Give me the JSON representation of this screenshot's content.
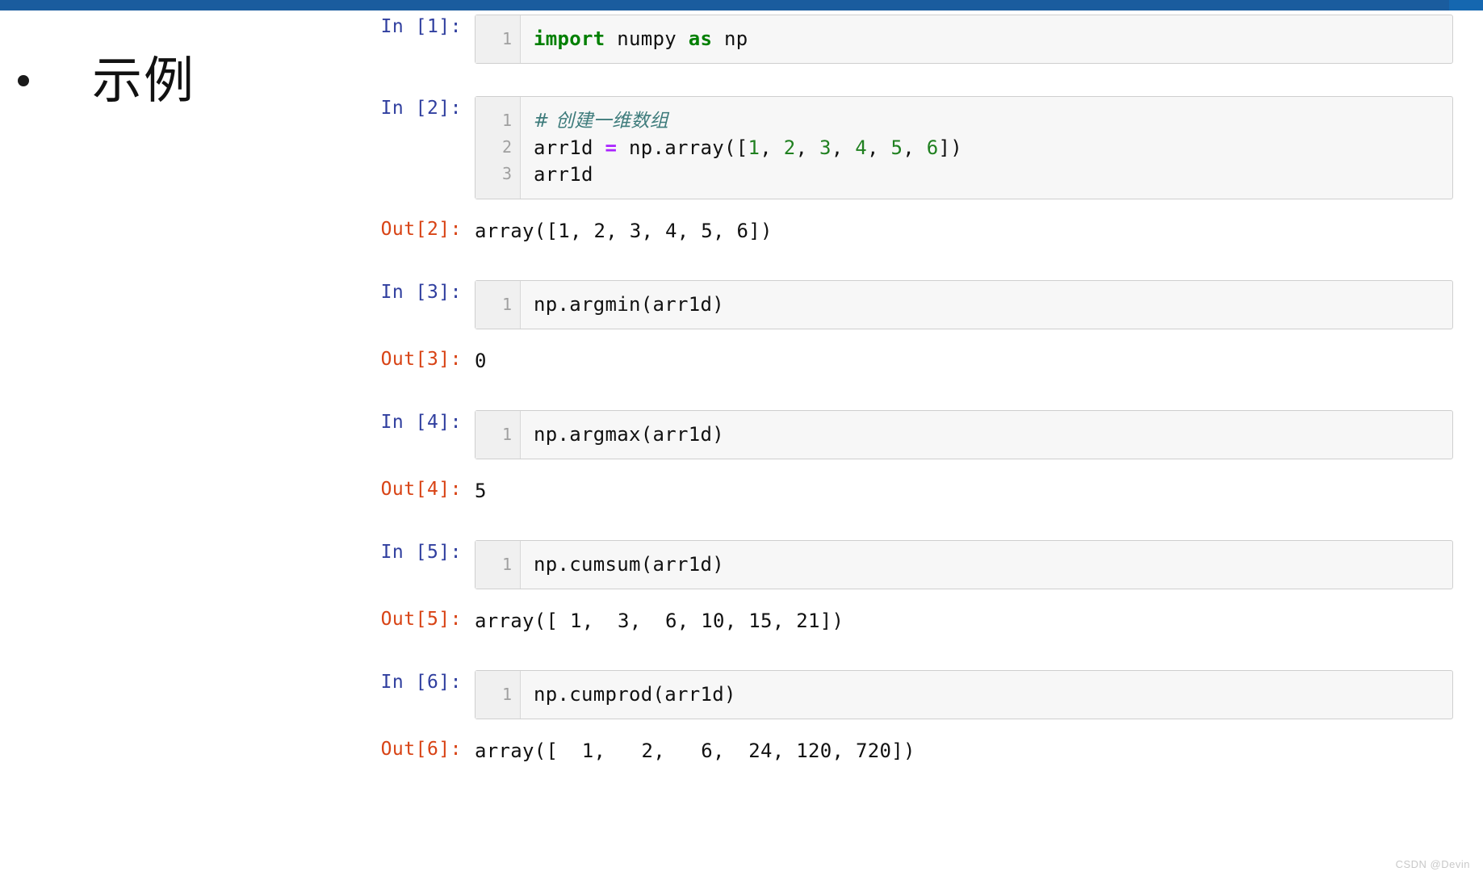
{
  "theme": {
    "top_bar_color": "#1A5C9E",
    "top_bar_accent_color": "#1567B0",
    "in_prompt_color": "#303F9F",
    "out_prompt_color": "#D84315",
    "keyword_color": "#007F00",
    "number_color": "#208020",
    "operator_color": "#AA22FF",
    "comment_color": "#3D7B7B",
    "cell_background": "#f7f7f7",
    "cell_border": "#cfcfcf"
  },
  "slide": {
    "bullet_text": "示例",
    "bullet_marker": "•"
  },
  "watermark": {
    "text": "CSDN @Devin"
  },
  "notebook": {
    "cells": [
      {
        "prompt": "In [1]:",
        "line_numbers": "1",
        "code_tokens": [
          {
            "text": "import",
            "type": "keyword"
          },
          {
            "text": " numpy ",
            "type": "plain"
          },
          {
            "text": "as",
            "type": "keyword"
          },
          {
            "text": " np",
            "type": "plain"
          }
        ],
        "code_plain": "import numpy as np",
        "output": null
      },
      {
        "prompt": "In [2]:",
        "line_numbers": "1\n2\n3",
        "code_tokens": [
          {
            "text": "# 创建一维数组",
            "type": "comment"
          },
          {
            "text": "\n",
            "type": "plain"
          },
          {
            "text": "arr1d ",
            "type": "plain"
          },
          {
            "text": "=",
            "type": "operator"
          },
          {
            "text": " np.array([",
            "type": "plain"
          },
          {
            "text": "1",
            "type": "number"
          },
          {
            "text": ", ",
            "type": "plain"
          },
          {
            "text": "2",
            "type": "number"
          },
          {
            "text": ", ",
            "type": "plain"
          },
          {
            "text": "3",
            "type": "number"
          },
          {
            "text": ", ",
            "type": "plain"
          },
          {
            "text": "4",
            "type": "number"
          },
          {
            "text": ", ",
            "type": "plain"
          },
          {
            "text": "5",
            "type": "number"
          },
          {
            "text": ", ",
            "type": "plain"
          },
          {
            "text": "6",
            "type": "number"
          },
          {
            "text": "])",
            "type": "plain"
          },
          {
            "text": "\n",
            "type": "plain"
          },
          {
            "text": "arr1d",
            "type": "plain"
          }
        ],
        "code_plain": "# 创建一维数组\narr1d = np.array([1, 2, 3, 4, 5, 6])\narr1d",
        "output": {
          "prompt": "Out[2]:",
          "text": "array([1, 2, 3, 4, 5, 6])"
        }
      },
      {
        "prompt": "In [3]:",
        "line_numbers": "1",
        "code_tokens": [
          {
            "text": "np.argmin(arr1d)",
            "type": "plain"
          }
        ],
        "code_plain": "np.argmin(arr1d)",
        "output": {
          "prompt": "Out[3]:",
          "text": "0"
        }
      },
      {
        "prompt": "In [4]:",
        "line_numbers": "1",
        "code_tokens": [
          {
            "text": "np.argmax(arr1d)",
            "type": "plain"
          }
        ],
        "code_plain": "np.argmax(arr1d)",
        "output": {
          "prompt": "Out[4]:",
          "text": "5"
        }
      },
      {
        "prompt": "In [5]:",
        "line_numbers": "1",
        "code_tokens": [
          {
            "text": "np.cumsum(arr1d)",
            "type": "plain"
          }
        ],
        "code_plain": "np.cumsum(arr1d)",
        "output": {
          "prompt": "Out[5]:",
          "text": "array([ 1,  3,  6, 10, 15, 21])"
        }
      },
      {
        "prompt": "In [6]:",
        "line_numbers": "1",
        "code_tokens": [
          {
            "text": "np.cumprod(arr1d)",
            "type": "plain"
          }
        ],
        "code_plain": "np.cumprod(arr1d)",
        "output": {
          "prompt": "Out[6]:",
          "text": "array([  1,   2,   6,  24, 120, 720])"
        }
      }
    ]
  }
}
